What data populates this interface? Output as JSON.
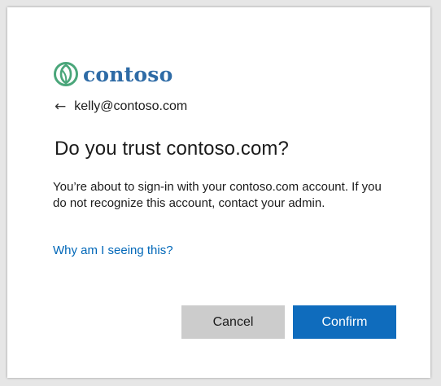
{
  "brand": {
    "name": "contoso",
    "logo_icon": "contoso-leaf-logo",
    "color": "#2e6ba6",
    "icon_color": "#4aa67a"
  },
  "identity": {
    "back_icon": "back-arrow-icon",
    "back_glyph": "←",
    "email": "kelly@contoso.com"
  },
  "title": "Do you trust contoso.com?",
  "message": "You’re about to sign-in with your contoso.com account. If you do not recognize this account, contact your admin.",
  "help_link": "Why am I seeing this?",
  "buttons": {
    "cancel": "Cancel",
    "confirm": "Confirm"
  },
  "colors": {
    "link": "#0067b8",
    "primary_button": "#0f6cbd",
    "secondary_button": "#cccccc"
  }
}
